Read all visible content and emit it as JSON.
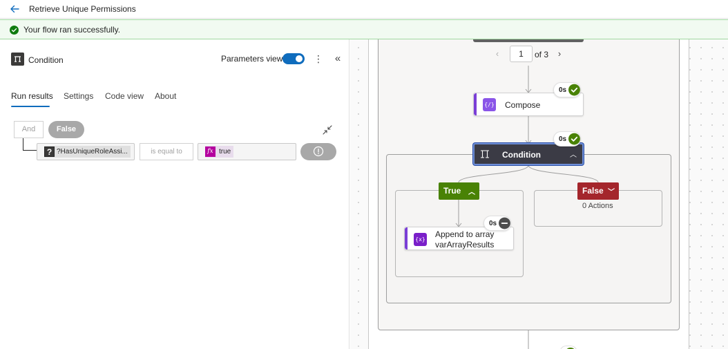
{
  "header": {
    "title": "Retrieve Unique Permissions"
  },
  "banner": {
    "message": "Your flow ran successfully."
  },
  "panel": {
    "title": "Condition",
    "parameters_view_label": "Parameters view",
    "parameters_view_on": true,
    "tabs": [
      {
        "label": "Run results",
        "active": true
      },
      {
        "label": "Settings",
        "active": false
      },
      {
        "label": "Code view",
        "active": false
      },
      {
        "label": "About",
        "active": false
      }
    ],
    "condition": {
      "group_operator": "And",
      "result": "False",
      "left_operand": "?HasUniqueRoleAssi...",
      "operator": "is equal to",
      "right_operand": "true"
    }
  },
  "canvas": {
    "pager": {
      "current": "1",
      "of_label": "of 3"
    },
    "compose": {
      "label": "Compose",
      "duration": "0s",
      "status": "succeeded"
    },
    "condition": {
      "label": "Condition",
      "duration": "0s",
      "status": "succeeded"
    },
    "true_branch": {
      "label": "True",
      "action": {
        "line1": "Append to array",
        "line2": "varArrayResults",
        "duration": "0s",
        "status": "skipped"
      }
    },
    "false_branch": {
      "label": "False",
      "actions_text": "0 Actions"
    }
  },
  "colors": {
    "accent": "#0f6cbd",
    "success": "#498205",
    "failure": "#a4262c",
    "banner_bg": "#f1faf1",
    "variable_purple": "#8a55e8",
    "expression_magenta": "#b4009e"
  },
  "icons": {
    "back": "arrow-left-icon",
    "banner": "check-circle-icon",
    "panel": "condition-icon",
    "more": "more-vertical-icon",
    "collapse": "double-chevron-left-icon",
    "expand": "collapse-arrows-icon",
    "status": "info-circle-icon",
    "variable": "variable-icon",
    "success": "check-circle-icon",
    "skipped": "minus-circle-icon"
  }
}
